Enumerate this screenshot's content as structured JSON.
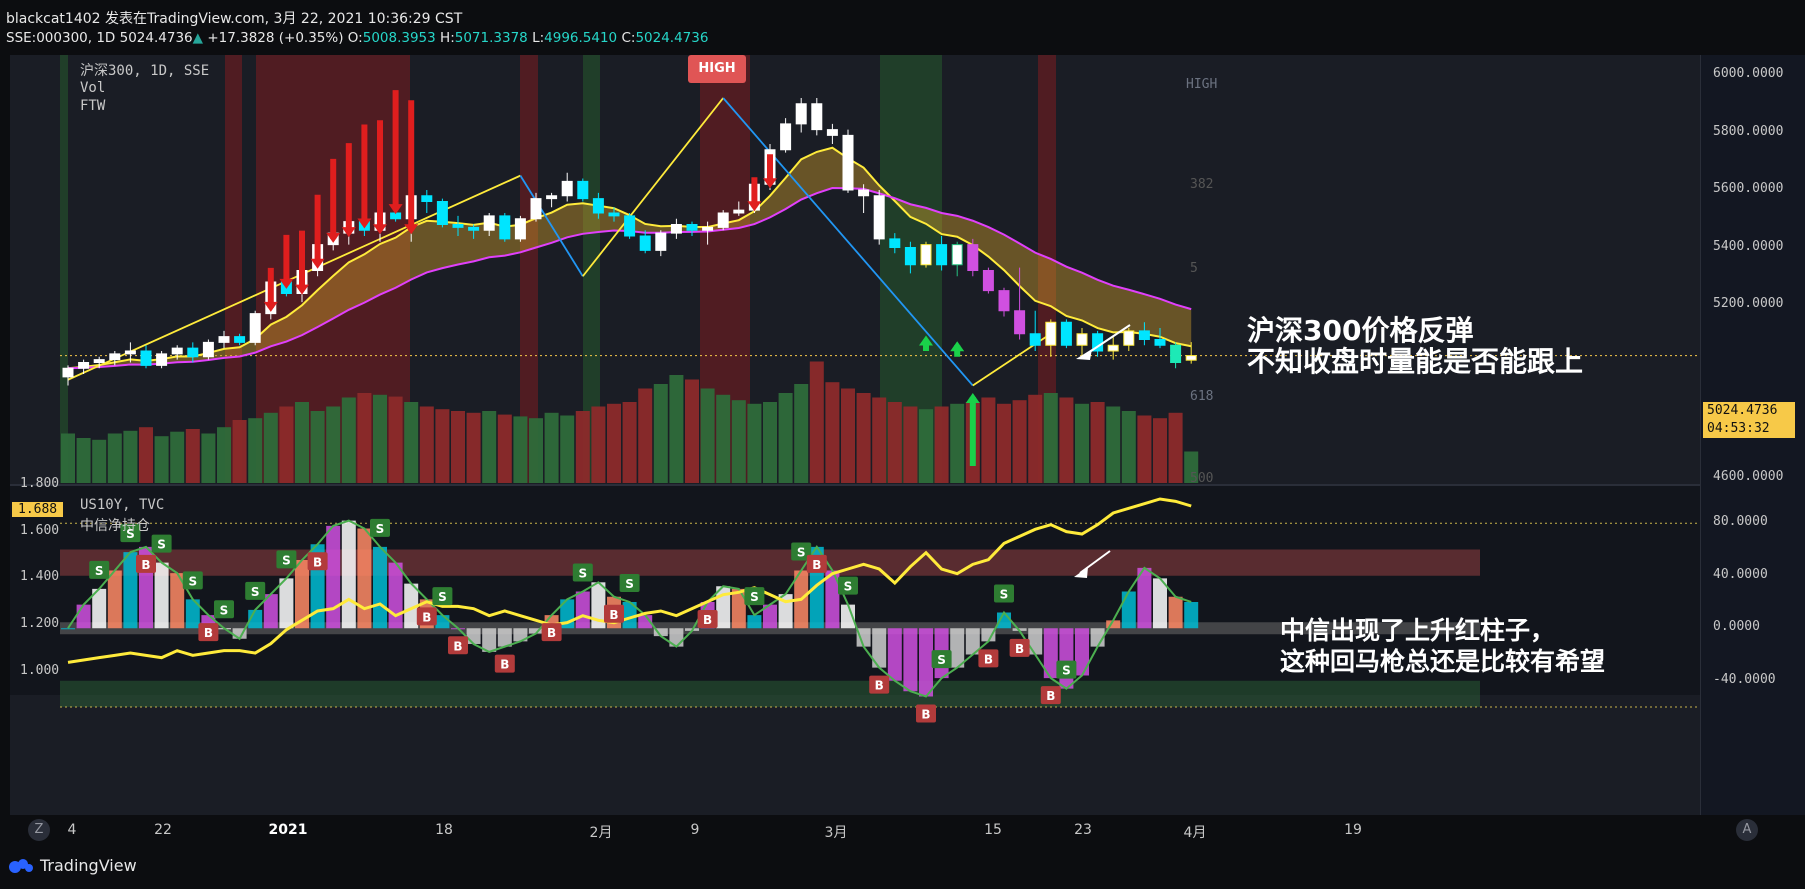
{
  "header": {
    "line1": "blackcat1402 发表在TradingView.com, 3月 22, 2021 10:36:29 CST",
    "symbol": "SSE:000300, 1D",
    "price": "5024.4736",
    "change": "+17.3828 (+0.35%)",
    "o_label": "O:",
    "o_value": "5008.3953",
    "h_label": "H:",
    "h_value": "5071.3378",
    "l_label": "L:",
    "l_value": "4996.5410",
    "c_label": "C:",
    "c_value": "5024.4736"
  },
  "legend": {
    "main": [
      "沪深300, 1D, SSE",
      "Vol",
      "FTW"
    ],
    "sub": [
      "US10Y, TVC",
      "中信净持仓"
    ]
  },
  "chart_labels": {
    "high_badge": "HIGH",
    "fib_high": "HIGH",
    "fib_382": "382",
    "fib_5": "5",
    "fib_618": "618",
    "fib_500": "500"
  },
  "price_axis": {
    "ticks": [
      "6000.0000",
      "5800.0000",
      "5600.0000",
      "5400.0000",
      "5200.0000",
      "4800.0000",
      "4600.0000"
    ],
    "last_price": "5024.4736",
    "countdown": "04:53:32"
  },
  "sub_axis_left": {
    "ticks": [
      "1.800",
      "1.600",
      "1.400",
      "1.200",
      "1.000"
    ],
    "current": "1.688"
  },
  "sub_axis_right": {
    "ticks": [
      "80.0000",
      "40.0000",
      "0.0000",
      "-40.0000"
    ]
  },
  "time_axis": {
    "labels": [
      "4",
      "22",
      "2021",
      "18",
      "2月",
      "9",
      "3月",
      "15",
      "23",
      "4月",
      "19"
    ],
    "left_button": "Z",
    "right_button": "A"
  },
  "annotations": {
    "top": [
      "沪深300价格反弹",
      "不知收盘时量能是否能跟上"
    ],
    "bottom": [
      "中信出现了上升红柱子，",
      "这种回马枪总还是比较有希望"
    ]
  },
  "footer": {
    "brand": "TradingView"
  },
  "colors": {
    "up": "#26a69a",
    "down": "#ef5350",
    "candle_up_body": "#ffffff",
    "cyan": "#00e5ff",
    "magenta": "#d050e0",
    "yellow": "#ffeb3b",
    "pink": "#e040fb",
    "green_zone": "#2e7d32",
    "red_zone": "#b71c1c"
  },
  "chart_data": {
    "type": "candlestick",
    "title": "沪深300, 1D, SSE",
    "ylim": [
      4600,
      6050
    ],
    "y_ticks": [
      4600,
      4800,
      5000,
      5200,
      5400,
      5600,
      5800,
      6000
    ],
    "candles": [
      [
        4950,
        4990,
        4920,
        4980
      ],
      [
        4980,
        5010,
        4960,
        5000
      ],
      [
        5000,
        5020,
        4980,
        5010
      ],
      [
        5010,
        5040,
        4990,
        5030
      ],
      [
        5030,
        5070,
        5000,
        5040
      ],
      [
        5040,
        5060,
        4980,
        4990
      ],
      [
        4990,
        5040,
        4980,
        5030
      ],
      [
        5030,
        5060,
        5010,
        5050
      ],
      [
        5050,
        5070,
        5000,
        5020
      ],
      [
        5020,
        5080,
        5010,
        5070
      ],
      [
        5070,
        5110,
        5050,
        5090
      ],
      [
        5090,
        5100,
        5060,
        5070
      ],
      [
        5070,
        5180,
        5060,
        5170
      ],
      [
        5170,
        5290,
        5150,
        5280
      ],
      [
        5280,
        5330,
        5230,
        5240
      ],
      [
        5240,
        5330,
        5210,
        5320
      ],
      [
        5320,
        5420,
        5300,
        5410
      ],
      [
        5410,
        5480,
        5390,
        5450
      ],
      [
        5450,
        5520,
        5410,
        5490
      ],
      [
        5490,
        5520,
        5440,
        5460
      ],
      [
        5460,
        5550,
        5420,
        5520
      ],
      [
        5520,
        5560,
        5490,
        5500
      ],
      [
        5500,
        5610,
        5420,
        5580
      ],
      [
        5580,
        5600,
        5520,
        5560
      ],
      [
        5560,
        5570,
        5470,
        5480
      ],
      [
        5480,
        5510,
        5440,
        5470
      ],
      [
        5470,
        5480,
        5430,
        5460
      ],
      [
        5460,
        5520,
        5440,
        5510
      ],
      [
        5510,
        5520,
        5420,
        5430
      ],
      [
        5430,
        5510,
        5420,
        5500
      ],
      [
        5500,
        5590,
        5490,
        5570
      ],
      [
        5570,
        5590,
        5540,
        5580
      ],
      [
        5580,
        5660,
        5560,
        5630
      ],
      [
        5630,
        5640,
        5560,
        5570
      ],
      [
        5570,
        5590,
        5500,
        5520
      ],
      [
        5520,
        5540,
        5490,
        5510
      ],
      [
        5510,
        5520,
        5430,
        5440
      ],
      [
        5440,
        5460,
        5380,
        5390
      ],
      [
        5390,
        5460,
        5370,
        5450
      ],
      [
        5450,
        5500,
        5430,
        5480
      ],
      [
        5480,
        5490,
        5440,
        5460
      ],
      [
        5460,
        5490,
        5410,
        5470
      ],
      [
        5470,
        5530,
        5460,
        5520
      ],
      [
        5520,
        5560,
        5510,
        5530
      ],
      [
        5530,
        5640,
        5520,
        5620
      ],
      [
        5620,
        5760,
        5600,
        5740
      ],
      [
        5740,
        5850,
        5730,
        5830
      ],
      [
        5830,
        5920,
        5800,
        5900
      ],
      [
        5900,
        5920,
        5790,
        5810
      ],
      [
        5810,
        5830,
        5760,
        5790
      ],
      [
        5790,
        5810,
        5590,
        5600
      ],
      [
        5600,
        5620,
        5520,
        5580
      ],
      [
        5580,
        5600,
        5410,
        5430
      ],
      [
        5430,
        5450,
        5380,
        5400
      ],
      [
        5400,
        5420,
        5310,
        5340
      ],
      [
        5340,
        5420,
        5330,
        5410
      ],
      [
        5410,
        5440,
        5320,
        5340
      ],
      [
        5340,
        5420,
        5300,
        5410
      ],
      [
        5410,
        5430,
        5300,
        5320
      ],
      [
        5320,
        5330,
        5240,
        5250
      ],
      [
        5250,
        5260,
        5160,
        5180
      ],
      [
        5180,
        5330,
        5080,
        5100
      ],
      [
        5100,
        5180,
        5040,
        5060
      ],
      [
        5060,
        5150,
        5020,
        5140
      ],
      [
        5140,
        5150,
        5050,
        5060
      ],
      [
        5060,
        5120,
        5020,
        5100
      ],
      [
        5100,
        5110,
        5020,
        5040
      ],
      [
        5040,
        5090,
        5010,
        5060
      ],
      [
        5060,
        5120,
        5040,
        5110
      ],
      [
        5110,
        5140,
        5060,
        5080
      ],
      [
        5080,
        5120,
        5050,
        5060
      ],
      [
        5060,
        5070,
        4980,
        5000
      ],
      [
        5008,
        5071,
        4996,
        5024
      ]
    ],
    "volume_relative": [
      0.55,
      0.5,
      0.48,
      0.55,
      0.58,
      0.62,
      0.52,
      0.57,
      0.6,
      0.55,
      0.62,
      0.7,
      0.72,
      0.78,
      0.85,
      0.9,
      0.8,
      0.85,
      0.95,
      1.0,
      0.98,
      0.96,
      0.9,
      0.85,
      0.82,
      0.8,
      0.78,
      0.8,
      0.76,
      0.74,
      0.72,
      0.78,
      0.75,
      0.8,
      0.85,
      0.88,
      0.9,
      1.05,
      1.1,
      1.2,
      1.15,
      1.05,
      0.98,
      0.92,
      0.88,
      0.9,
      1.0,
      1.1,
      1.35,
      1.12,
      1.05,
      1.0,
      0.95,
      0.9,
      0.85,
      0.82,
      0.85,
      0.88,
      0.9,
      0.95,
      0.88,
      0.92,
      0.98,
      1.0,
      0.95,
      0.88,
      0.9,
      0.85,
      0.8,
      0.75,
      0.72,
      0.78,
      0.35
    ],
    "sub_us10y": [
      1.04,
      1.05,
      1.06,
      1.07,
      1.08,
      1.07,
      1.06,
      1.09,
      1.07,
      1.08,
      1.09,
      1.09,
      1.08,
      1.12,
      1.18,
      1.22,
      1.26,
      1.27,
      1.31,
      1.27,
      1.29,
      1.24,
      1.27,
      1.3,
      1.28,
      1.28,
      1.27,
      1.24,
      1.26,
      1.24,
      1.22,
      1.2,
      1.21,
      1.24,
      1.22,
      1.21,
      1.23,
      1.25,
      1.26,
      1.24,
      1.27,
      1.3,
      1.33,
      1.34,
      1.36,
      1.33,
      1.3,
      1.31,
      1.37,
      1.42,
      1.44,
      1.46,
      1.44,
      1.38,
      1.45,
      1.51,
      1.44,
      1.42,
      1.46,
      1.48,
      1.55,
      1.58,
      1.61,
      1.63,
      1.6,
      1.59,
      1.63,
      1.68,
      1.7,
      1.72,
      1.74,
      1.73,
      1.71
    ],
    "sub_zx_net": [
      0,
      18,
      30,
      44,
      58,
      62,
      50,
      42,
      22,
      10,
      0,
      -8,
      14,
      26,
      38,
      52,
      64,
      78,
      82,
      76,
      62,
      50,
      34,
      22,
      10,
      0,
      -12,
      -18,
      -14,
      -10,
      -4,
      10,
      22,
      28,
      35,
      24,
      20,
      10,
      -6,
      -14,
      -2,
      20,
      32,
      30,
      10,
      18,
      26,
      44,
      62,
      44,
      18,
      -14,
      -30,
      -40,
      -48,
      -52,
      -38,
      -30,
      -20,
      -10,
      12,
      -2,
      -20,
      -38,
      -46,
      -36,
      -14,
      6,
      28,
      46,
      38,
      24,
      20
    ],
    "sub_left_range": [
      0.9,
      1.8
    ],
    "sub_right_range": [
      -60,
      100
    ]
  }
}
